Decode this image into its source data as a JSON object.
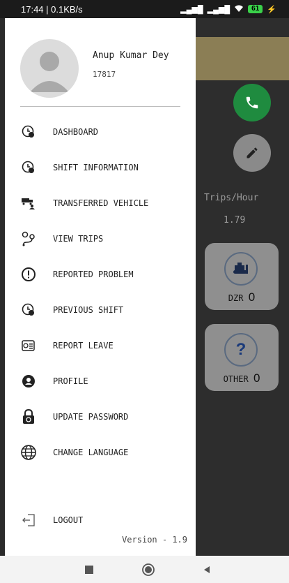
{
  "status_bar": {
    "time_speed": "17:44 | 0.1KB/s",
    "battery": "61"
  },
  "user": {
    "name": "Anup Kumar Dey",
    "id": "17817"
  },
  "menu": [
    {
      "label": "DASHBOARD",
      "icon": "dashboard-clock-icon"
    },
    {
      "label": "SHIFT INFORMATION",
      "icon": "shift-clock-icon"
    },
    {
      "label": "TRANSFERRED VEHICLE",
      "icon": "transfer-truck-icon"
    },
    {
      "label": "VIEW TRIPS",
      "icon": "route-icon"
    },
    {
      "label": "REPORTED PROBLEM",
      "icon": "alert-icon"
    },
    {
      "label": "PREVIOUS SHIFT",
      "icon": "previous-clock-icon"
    },
    {
      "label": "REPORT LEAVE",
      "icon": "leave-icon"
    },
    {
      "label": "PROFILE",
      "icon": "profile-icon"
    },
    {
      "label": "UPDATE PASSWORD",
      "icon": "lock-icon"
    },
    {
      "label": "CHANGE LANGUAGE",
      "icon": "globe-icon"
    }
  ],
  "logout_label": "LOGOUT",
  "version": "Version - 1.9",
  "background": {
    "trips_label": "Trips/Hour",
    "trips_value": "1.79",
    "tiles": [
      {
        "label": "DZR",
        "count": "0",
        "icon": "dozer-icon"
      },
      {
        "label": "OTHER",
        "count": "0",
        "icon": "question-icon"
      }
    ]
  },
  "colors": {
    "call_fab": "#1f8b3f",
    "edit_fab": "#8a8a8a",
    "band": "#8b7e55"
  }
}
